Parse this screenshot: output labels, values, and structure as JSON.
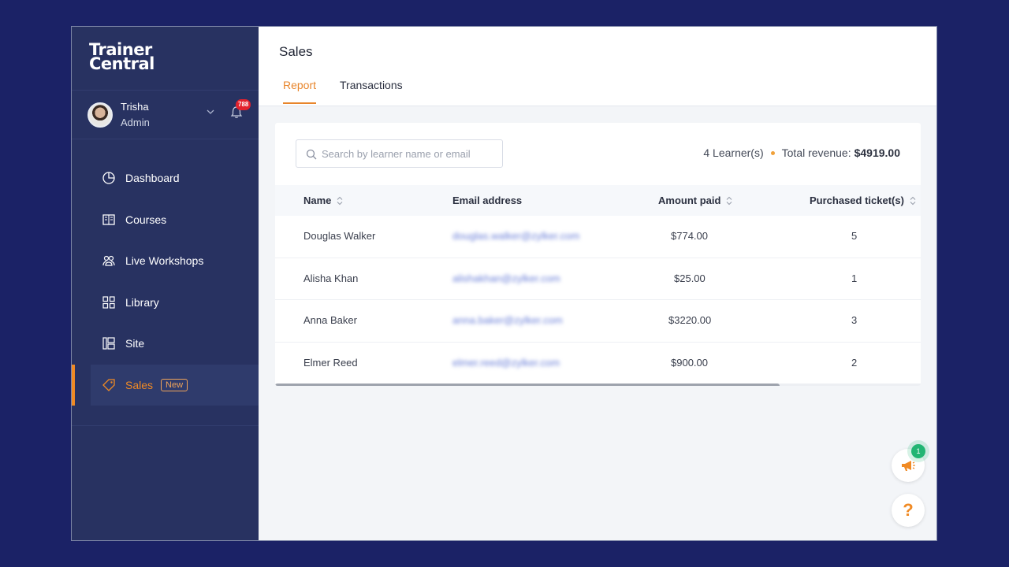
{
  "app": {
    "logo_line1": "Trainer",
    "logo_line2": "Central"
  },
  "user": {
    "name": "Trisha",
    "role": "Admin",
    "notification_count": "788"
  },
  "sidebar": {
    "items": [
      {
        "label": "Dashboard",
        "icon": "pie-chart-icon"
      },
      {
        "label": "Courses",
        "icon": "book-icon"
      },
      {
        "label": "Live Workshops",
        "icon": "workshop-icon"
      },
      {
        "label": "Library",
        "icon": "grid-icon"
      },
      {
        "label": "Site",
        "icon": "layout-icon"
      },
      {
        "label": "Sales",
        "icon": "tag-icon",
        "tag": "New",
        "active": true
      }
    ]
  },
  "header": {
    "title": "Sales",
    "tabs": [
      {
        "label": "Report",
        "active": true
      },
      {
        "label": "Transactions",
        "active": false
      }
    ]
  },
  "report": {
    "search_placeholder": "Search by learner name or email",
    "learners": "4 Learner(s)",
    "revenue_label": "Total revenue:",
    "revenue_value": "$4919.00",
    "columns": [
      "Name",
      "Email address",
      "Amount paid",
      "Purchased ticket(s)"
    ],
    "rows": [
      {
        "name": "Douglas Walker",
        "email": "douglas.walker@zylker.com",
        "amount": "$774.00",
        "tickets": "5"
      },
      {
        "name": "Alisha Khan",
        "email": "alishakhan@zylker.com",
        "amount": "$25.00",
        "tickets": "1"
      },
      {
        "name": "Anna Baker",
        "email": "anna.baker@zylker.com",
        "amount": "$3220.00",
        "tickets": "3"
      },
      {
        "name": "Elmer Reed",
        "email": "elmer.reed@zylker.com",
        "amount": "$900.00",
        "tickets": "2"
      }
    ]
  },
  "widgets": {
    "announcement_count": "1",
    "help_glyph": "?"
  },
  "colors": {
    "accent": "#f08a24",
    "sidebar": "#283261",
    "background": "#1b2266"
  }
}
